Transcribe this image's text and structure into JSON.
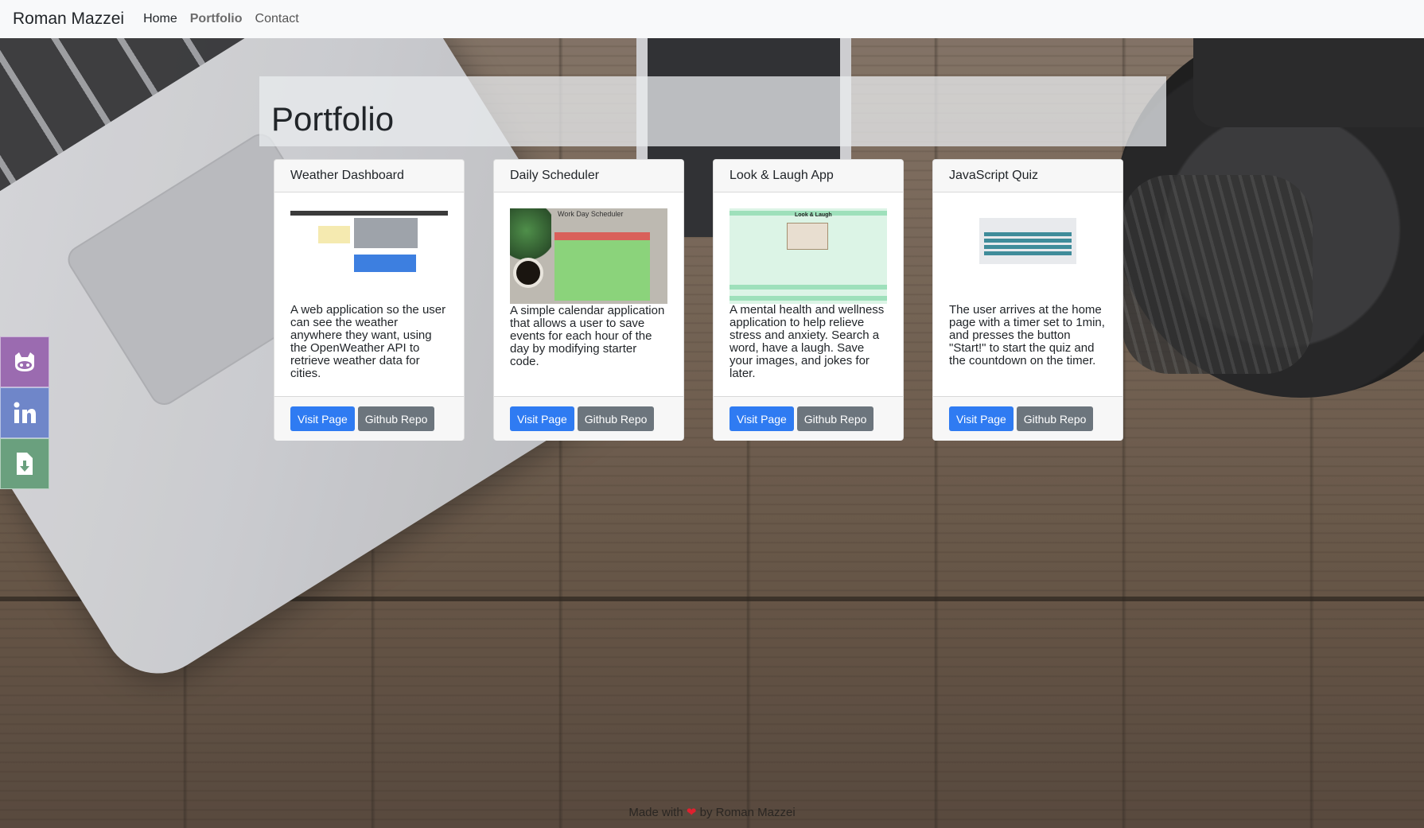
{
  "navbar": {
    "brand": "Roman Mazzei",
    "links": [
      "Home",
      "Portfolio",
      "Contact"
    ],
    "active": "Portfolio"
  },
  "social": {
    "items": [
      {
        "name": "github",
        "icon": "github-icon",
        "color": "#9b6bb0"
      },
      {
        "name": "linkedin",
        "icon": "linkedin-icon",
        "color": "#6f86c9"
      },
      {
        "name": "resume",
        "icon": "download-file-icon",
        "color": "#6aa07e"
      }
    ]
  },
  "portfolio": {
    "title": "Portfolio",
    "cards": [
      {
        "title": "Weather Dashboard",
        "description": "A web application so the user can see the weather anywhere they want, using the OpenWeather API to retrieve weather data for cities.",
        "visit_label": "Visit Page",
        "repo_label": "Github Repo"
      },
      {
        "title": "Daily Scheduler",
        "description": "A simple calendar application that allows a user to save events for each hour of the day by modifying starter code.",
        "visit_label": "Visit Page",
        "repo_label": "Github Repo",
        "thumb_title": "Work Day Scheduler"
      },
      {
        "title": "Look & Laugh App",
        "description": "A mental health and wellness application to help relieve stress and anxiety. Search a word, have a laugh. Save your images, and jokes for later.",
        "visit_label": "Visit Page",
        "repo_label": "Github Repo",
        "thumb_title": "Look & Laugh"
      },
      {
        "title": "JavaScript Quiz",
        "description": "The user arrives at the home page with a timer set to 1min, and presses the button \"Start!\" to start the quiz and the countdown on the timer.",
        "visit_label": "Visit Page",
        "repo_label": "Github Repo"
      }
    ]
  },
  "footer": {
    "prefix": "Made with",
    "heart": "❤",
    "suffix": "by Roman Mazzei"
  },
  "colors": {
    "primary_button": "#2f7bf2",
    "secondary_button": "#6c757d",
    "navbar_bg": "#f8f9fa"
  }
}
